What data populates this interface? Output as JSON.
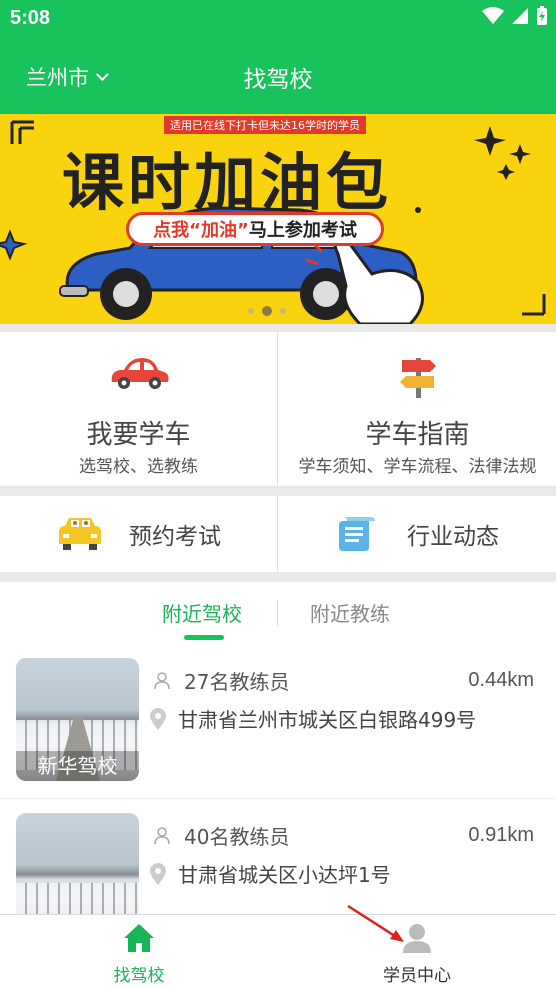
{
  "status_bar": {
    "time": "5:08"
  },
  "header": {
    "city": "兰州市",
    "title": "找驾校"
  },
  "banner": {
    "notice": "适用已在线下打卡但未达16学时的学员",
    "title": "课时加油包",
    "cta_prefix": "点我",
    "cta_highlight": "“加油”",
    "cta_suffix": "马上参加考试"
  },
  "features": [
    {
      "label": "我要学车",
      "sub": "选驾校、选教练",
      "icon": "car-icon"
    },
    {
      "label": "学车指南",
      "sub": "学车须知、学车流程、法律法规",
      "icon": "signpost-icon"
    }
  ],
  "quick_links": [
    {
      "label": "预约考试",
      "icon": "taxi-icon"
    },
    {
      "label": "行业动态",
      "icon": "scroll-icon"
    }
  ],
  "tabs": [
    {
      "label": "附近驾校",
      "active": true
    },
    {
      "label": "附近教练",
      "active": false
    }
  ],
  "schools": [
    {
      "name": "新华驾校",
      "coaches": "27名教练员",
      "distance": "0.44km",
      "address": "甘肃省兰州市城关区白银路499号"
    },
    {
      "name": "",
      "coaches": "40名教练员",
      "distance": "0.91km",
      "address": "甘肃省城关区小达坪1号"
    }
  ],
  "bottom_nav": [
    {
      "label": "找驾校",
      "icon": "home-icon",
      "active": true
    },
    {
      "label": "学员中心",
      "icon": "user-icon",
      "active": false
    }
  ],
  "colors": {
    "brand": "#17c35a",
    "active_text": "#17b555",
    "banner_bg": "#f9d40e",
    "annotation_arrow": "#e0201a"
  }
}
